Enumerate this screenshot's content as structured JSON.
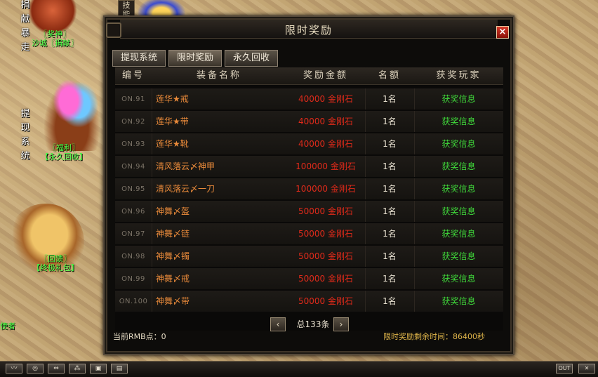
{
  "hud": {
    "left_labels": [
      "捐",
      "献",
      "暴",
      "走"
    ],
    "left_tag1_line1": "〖奖神〗",
    "left_tag1_line2": "沙城〖捐献〗",
    "withdraw_label": [
      "提",
      "现",
      "系",
      "统"
    ],
    "welfare_line1": "〖福利〗",
    "welfare_line2": "【永久回收】",
    "recycle_line1": "〖回馈〗",
    "recycle_line2": "【终极礼包】",
    "bottom_left_text": "使者",
    "skill_tab": [
      "技",
      "能"
    ]
  },
  "window": {
    "title": "限时奖励",
    "close_label": "×",
    "tabs": [
      {
        "label": "提现系统",
        "active": false
      },
      {
        "label": "限时奖励",
        "active": true
      },
      {
        "label": "永久回收",
        "active": false
      }
    ],
    "columns": {
      "no": "编号",
      "name": "装备名称",
      "amount": "奖励金额",
      "count": "名额",
      "player": "获奖玩家"
    },
    "rows": [
      {
        "no": "ON.91",
        "name": "莲华★戒",
        "amount": "40000",
        "unit": "金刚石",
        "count": "1名",
        "player": "获奖信息"
      },
      {
        "no": "ON.92",
        "name": "莲华★带",
        "amount": "40000",
        "unit": "金刚石",
        "count": "1名",
        "player": "获奖信息"
      },
      {
        "no": "ON.93",
        "name": "莲华★靴",
        "amount": "40000",
        "unit": "金刚石",
        "count": "1名",
        "player": "获奖信息"
      },
      {
        "no": "ON.94",
        "name": "清风落云〆神甲",
        "amount": "100000",
        "unit": "金刚石",
        "count": "1名",
        "player": "获奖信息"
      },
      {
        "no": "ON.95",
        "name": "清风落云〆一刀",
        "amount": "100000",
        "unit": "金刚石",
        "count": "1名",
        "player": "获奖信息"
      },
      {
        "no": "ON.96",
        "name": "神舞〆盔",
        "amount": "50000",
        "unit": "金刚石",
        "count": "1名",
        "player": "获奖信息"
      },
      {
        "no": "ON.97",
        "name": "神舞〆链",
        "amount": "50000",
        "unit": "金刚石",
        "count": "1名",
        "player": "获奖信息"
      },
      {
        "no": "ON.98",
        "name": "神舞〆镯",
        "amount": "50000",
        "unit": "金刚石",
        "count": "1名",
        "player": "获奖信息"
      },
      {
        "no": "ON.99",
        "name": "神舞〆戒",
        "amount": "50000",
        "unit": "金刚石",
        "count": "1名",
        "player": "获奖信息"
      },
      {
        "no": "ON.100",
        "name": "神舞〆带",
        "amount": "50000",
        "unit": "金刚石",
        "count": "1名",
        "player": "获奖信息"
      }
    ],
    "pager": {
      "prev": "‹",
      "next": "›",
      "total": "总133条"
    },
    "footer_left": "当前RMB点：0",
    "footer_right": "限时奖励剩余时间：86400秒"
  },
  "hotbar": {
    "buttons": [
      "〰",
      "◎",
      "⇔",
      "⁂",
      "▣",
      "▤"
    ],
    "out": "OUT",
    "x": "✕"
  },
  "colors": {
    "amount": "#e02a1a",
    "item_name": "#e98a3a",
    "winner_info": "#3fd83a",
    "close": "#d63a2a"
  }
}
